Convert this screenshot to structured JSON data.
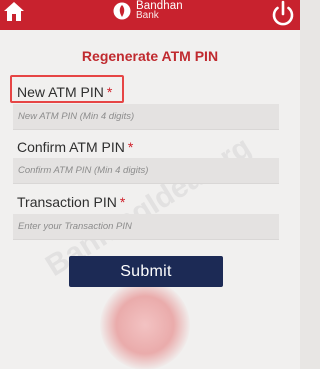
{
  "header": {
    "brand_name": "Bandhan",
    "brand_sub": "Bank",
    "background_color": "#c8222e",
    "home_icon": "home-icon",
    "power_icon": "power-icon"
  },
  "form": {
    "title": "Regenerate ATM PIN",
    "new_pin": {
      "label": "New ATM PIN",
      "required_mark": "*",
      "placeholder": "New ATM PIN (Min 4 digits)"
    },
    "confirm_pin": {
      "label": "Confirm ATM PIN",
      "required_mark": "*",
      "placeholder": "Confirm ATM PIN (Min 4 digits)"
    },
    "transaction_pin": {
      "label": "Transaction PIN",
      "required_mark": "*",
      "placeholder": "Enter your Transaction PIN"
    },
    "submit_label": "Submit",
    "submit_color": "#1c2a55",
    "title_color": "#c02a2f",
    "highlight_color": "#e64545"
  },
  "watermark": {
    "text": "BankingIdea.org"
  }
}
